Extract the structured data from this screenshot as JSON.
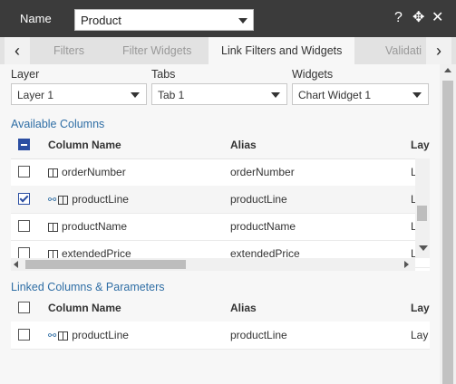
{
  "header": {
    "name_label": "Name",
    "name_value": "Product",
    "icons": [
      "help-icon",
      "move-icon",
      "close-icon"
    ]
  },
  "tabs": {
    "items": [
      {
        "label": "Filters",
        "active": false
      },
      {
        "label": "Filter Widgets",
        "active": false
      },
      {
        "label": "Link Filters and Widgets",
        "active": true
      },
      {
        "label": "Validati",
        "active": false
      }
    ]
  },
  "filters": {
    "layer": {
      "label": "Layer",
      "value": "Layer 1"
    },
    "tabs": {
      "label": "Tabs",
      "value": "Tab 1"
    },
    "widgets": {
      "label": "Widgets",
      "value": "Chart Widget 1"
    }
  },
  "available": {
    "title": "Available Columns",
    "headers": {
      "name": "Column Name",
      "alias": "Alias",
      "layer": "Lay"
    },
    "rows": [
      {
        "name": "orderNumber",
        "alias": "orderNumber",
        "layer": "L",
        "checked": false,
        "linked": false
      },
      {
        "name": "productLine",
        "alias": "productLine",
        "layer": "L",
        "checked": true,
        "linked": true
      },
      {
        "name": "productName",
        "alias": "productName",
        "layer": "L",
        "checked": false,
        "linked": false
      },
      {
        "name": "extendedPrice",
        "alias": "extendedPrice",
        "layer": "L",
        "checked": false,
        "linked": false
      }
    ]
  },
  "linked": {
    "title": "Linked Columns & Parameters",
    "headers": {
      "name": "Column Name",
      "alias": "Alias",
      "layer": "Lay"
    },
    "rows": [
      {
        "name": "productLine",
        "alias": "productLine",
        "layer": "Lay",
        "checked": false,
        "linked": true
      }
    ]
  }
}
